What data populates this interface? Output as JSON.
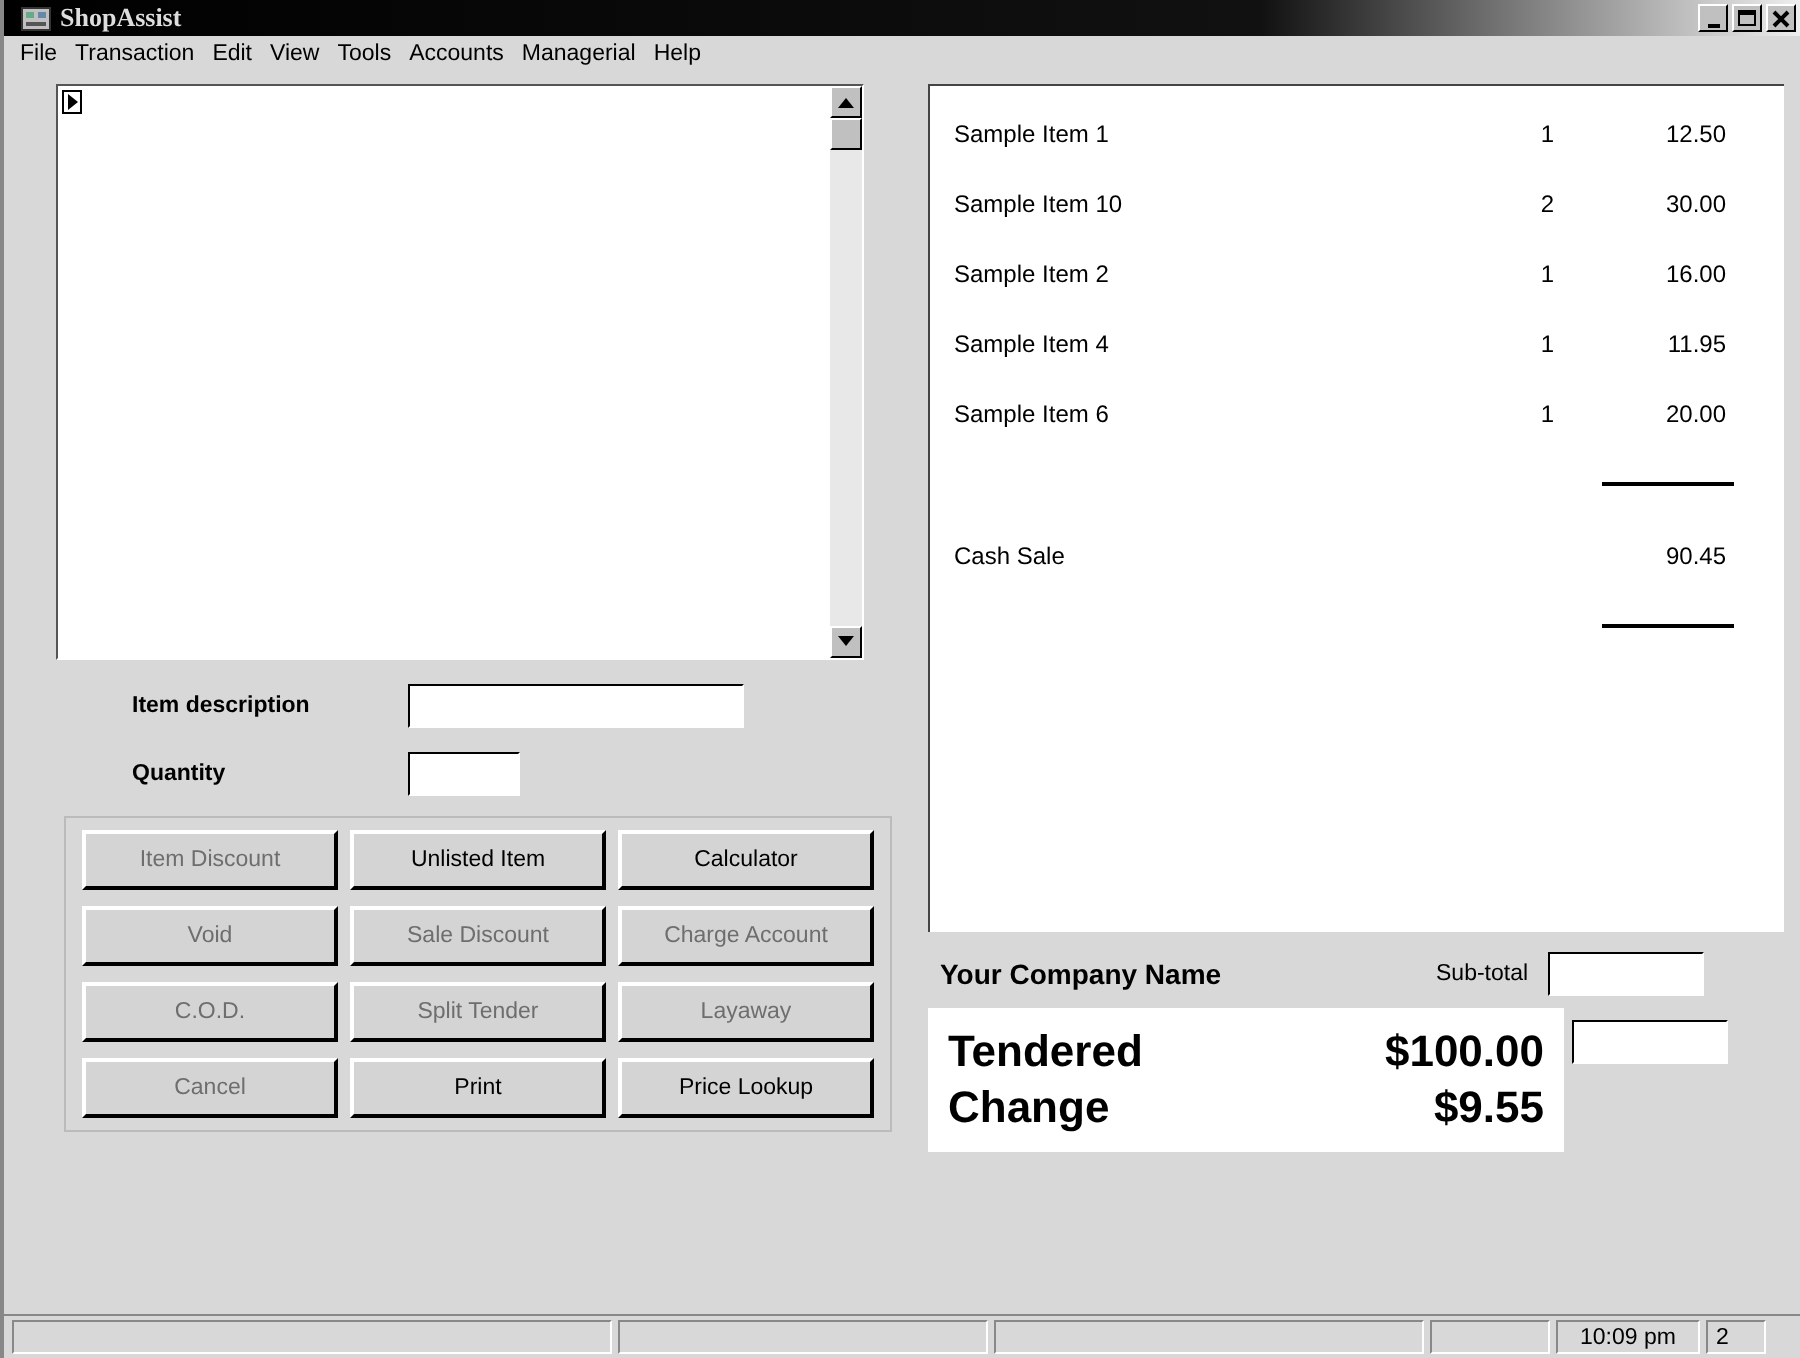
{
  "window": {
    "title": "ShopAssist"
  },
  "menu": [
    "File",
    "Transaction",
    "Edit",
    "View",
    "Tools",
    "Accounts",
    "Managerial",
    "Help"
  ],
  "item_description": {
    "label": "Item description"
  },
  "quantity": {
    "label": "Quantity"
  },
  "buttons": [
    {
      "label": "Item Discount",
      "disabled": true
    },
    {
      "label": "Unlisted Item",
      "disabled": false
    },
    {
      "label": "Calculator",
      "disabled": false
    },
    {
      "label": "Void",
      "disabled": true
    },
    {
      "label": "Sale Discount",
      "disabled": true
    },
    {
      "label": "Charge Account",
      "disabled": true
    },
    {
      "label": "C.O.D.",
      "disabled": true
    },
    {
      "label": "Split Tender",
      "disabled": true
    },
    {
      "label": "Layaway",
      "disabled": true
    },
    {
      "label": "Cancel",
      "disabled": true
    },
    {
      "label": "Print",
      "disabled": false
    },
    {
      "label": "Price Lookup",
      "disabled": false
    }
  ],
  "receipt": {
    "rows": [
      {
        "kind": "item",
        "name": "Sample Item 1",
        "qty": "1",
        "amount": "12.50"
      },
      {
        "kind": "item",
        "name": "Sample Item 10",
        "qty": "2",
        "amount": "30.00"
      },
      {
        "kind": "item",
        "name": "Sample Item 2",
        "qty": "1",
        "amount": "16.00"
      },
      {
        "kind": "item",
        "name": "Sample Item 4",
        "qty": "1",
        "amount": "11.95"
      },
      {
        "kind": "item",
        "name": "Sample Item 6",
        "qty": "1",
        "amount": "20.00"
      },
      {
        "kind": "rule"
      },
      {
        "kind": "total",
        "name": "Cash Sale",
        "amount": "90.45"
      },
      {
        "kind": "rule"
      }
    ]
  },
  "company": "Your Company Name",
  "subtotal": {
    "label": "Sub-total"
  },
  "tendered": {
    "label": "Tendered",
    "value": "$100.00"
  },
  "change": {
    "label": "Change",
    "value": "$9.55"
  },
  "status_bar": {
    "time": "10:09 pm",
    "count": "2"
  }
}
